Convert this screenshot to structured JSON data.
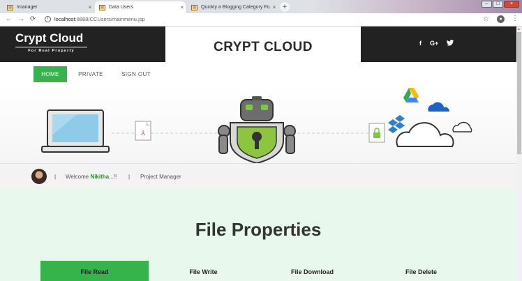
{
  "browser": {
    "tabs": [
      {
        "title": "/manager",
        "close": "×"
      },
      {
        "title": "Data Users",
        "close": "×"
      },
      {
        "title": "Quickly a Blogging Category Fo...",
        "close": "×"
      }
    ],
    "new_tab": "+",
    "address": {
      "host": "localhost",
      "path": ":8888/CCUsers/mainmenu.jsp"
    },
    "nav": {
      "back": "←",
      "forward": "→",
      "reload": "C"
    },
    "window": {
      "min": "–",
      "max": "□",
      "close": "×"
    }
  },
  "header": {
    "logo": "Crypt Cloud",
    "tagline": "For Real Property",
    "title": "CRYPT CLOUD",
    "social": [
      "f",
      "G+",
      "t"
    ]
  },
  "menu": {
    "items": [
      "HOME",
      "PRIVATE",
      "SIGN OUT"
    ],
    "active": "HOME"
  },
  "welcome": {
    "sep1": "|",
    "greeting": "Welcome",
    "name": "Nikitha",
    "suffix": "...!!",
    "sep2": "|",
    "role": "Project Manager"
  },
  "file_properties": {
    "title": "File Properties",
    "buttons": [
      "File Read",
      "File Write",
      "File Download",
      "File Delete"
    ],
    "active": "File Read"
  },
  "colors": {
    "accent": "#34b44a",
    "dark": "#222222",
    "section_bg": "#e8f8ec"
  }
}
